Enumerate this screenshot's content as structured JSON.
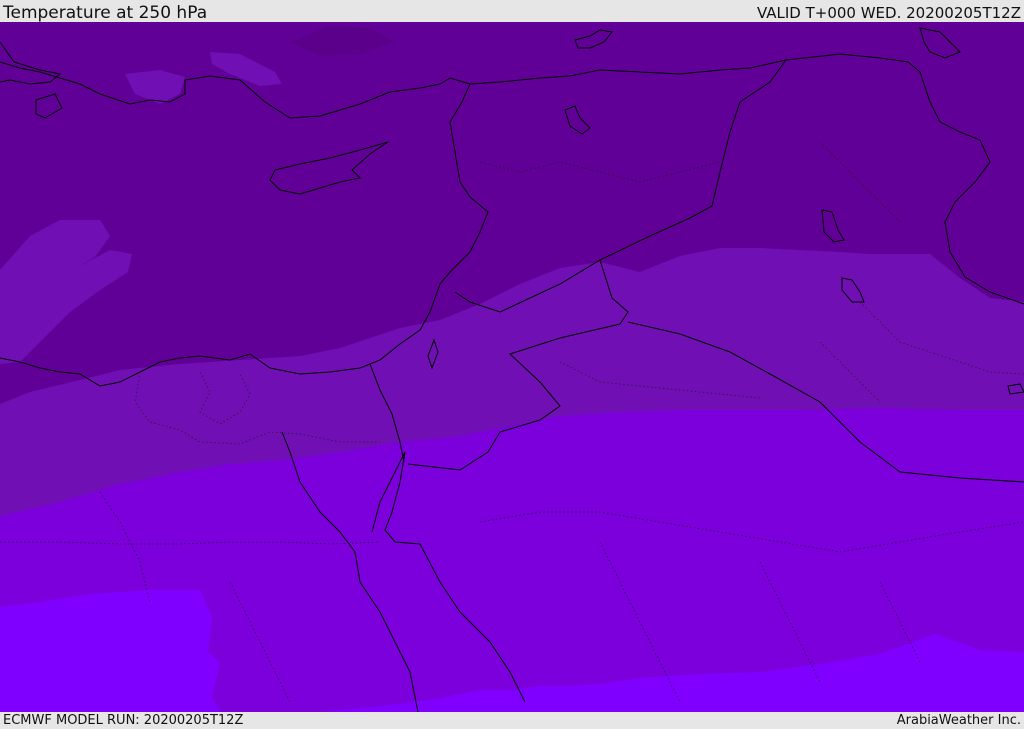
{
  "header": {
    "title": "Temperature at 250 hPa",
    "valid": "VALID T+000 WED. 20200205T12Z"
  },
  "footer": {
    "model_run": "ECMWF MODEL RUN: 20200205T12Z",
    "credit": "ArabiaWeather Inc."
  },
  "colors": {
    "band_coldest": "#610096",
    "band_cold": "#700fb3",
    "band_mid": "#7b00db",
    "band_warm": "#8000ff",
    "coast_line": "#000000",
    "border_line": "#1a1a1a"
  },
  "map": {
    "region": "Eastern Mediterranean / Middle East",
    "projection": "regional",
    "layers": [
      "temperature-fill",
      "coastlines",
      "country-borders",
      "admin-borders"
    ]
  }
}
